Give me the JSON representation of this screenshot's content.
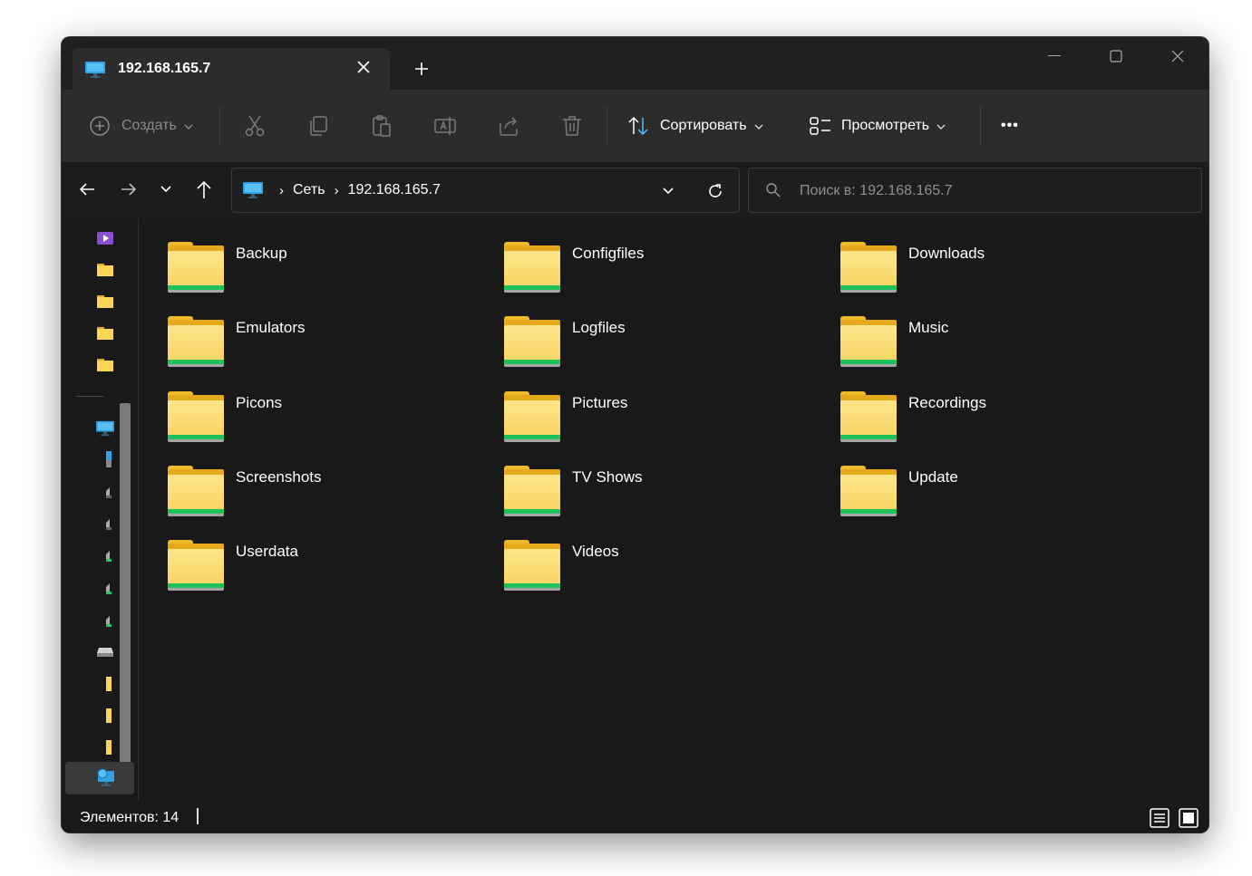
{
  "window": {
    "tab_title": "192.168.165.7",
    "icons": {
      "tab": "monitor-icon",
      "close": "close-icon",
      "new_tab": "plus-icon",
      "minimize": "minimize-icon",
      "maximize": "maximize-icon",
      "window_close": "close-icon"
    }
  },
  "toolbar": {
    "create_label": "Создать",
    "sort_label": "Сортировать",
    "view_label": "Просмотреть",
    "more_label": "•••"
  },
  "address": {
    "crumbs": [
      "Сеть",
      "192.168.165.7"
    ]
  },
  "search": {
    "placeholder": "Поиск в: 192.168.165.7"
  },
  "folders": [
    "Backup",
    "Configfiles",
    "Downloads",
    "Emulators",
    "Logfiles",
    "Music",
    "Picons",
    "Pictures",
    "Recordings",
    "Screenshots",
    "TV Shows",
    "Update",
    "Userdata",
    "Videos"
  ],
  "status": {
    "items_text": "Элементов: 14"
  },
  "colors": {
    "accent_blue": "#4cc2ff",
    "folder_yellow": "#f7d360",
    "folder_strip": "#1fc15a"
  }
}
